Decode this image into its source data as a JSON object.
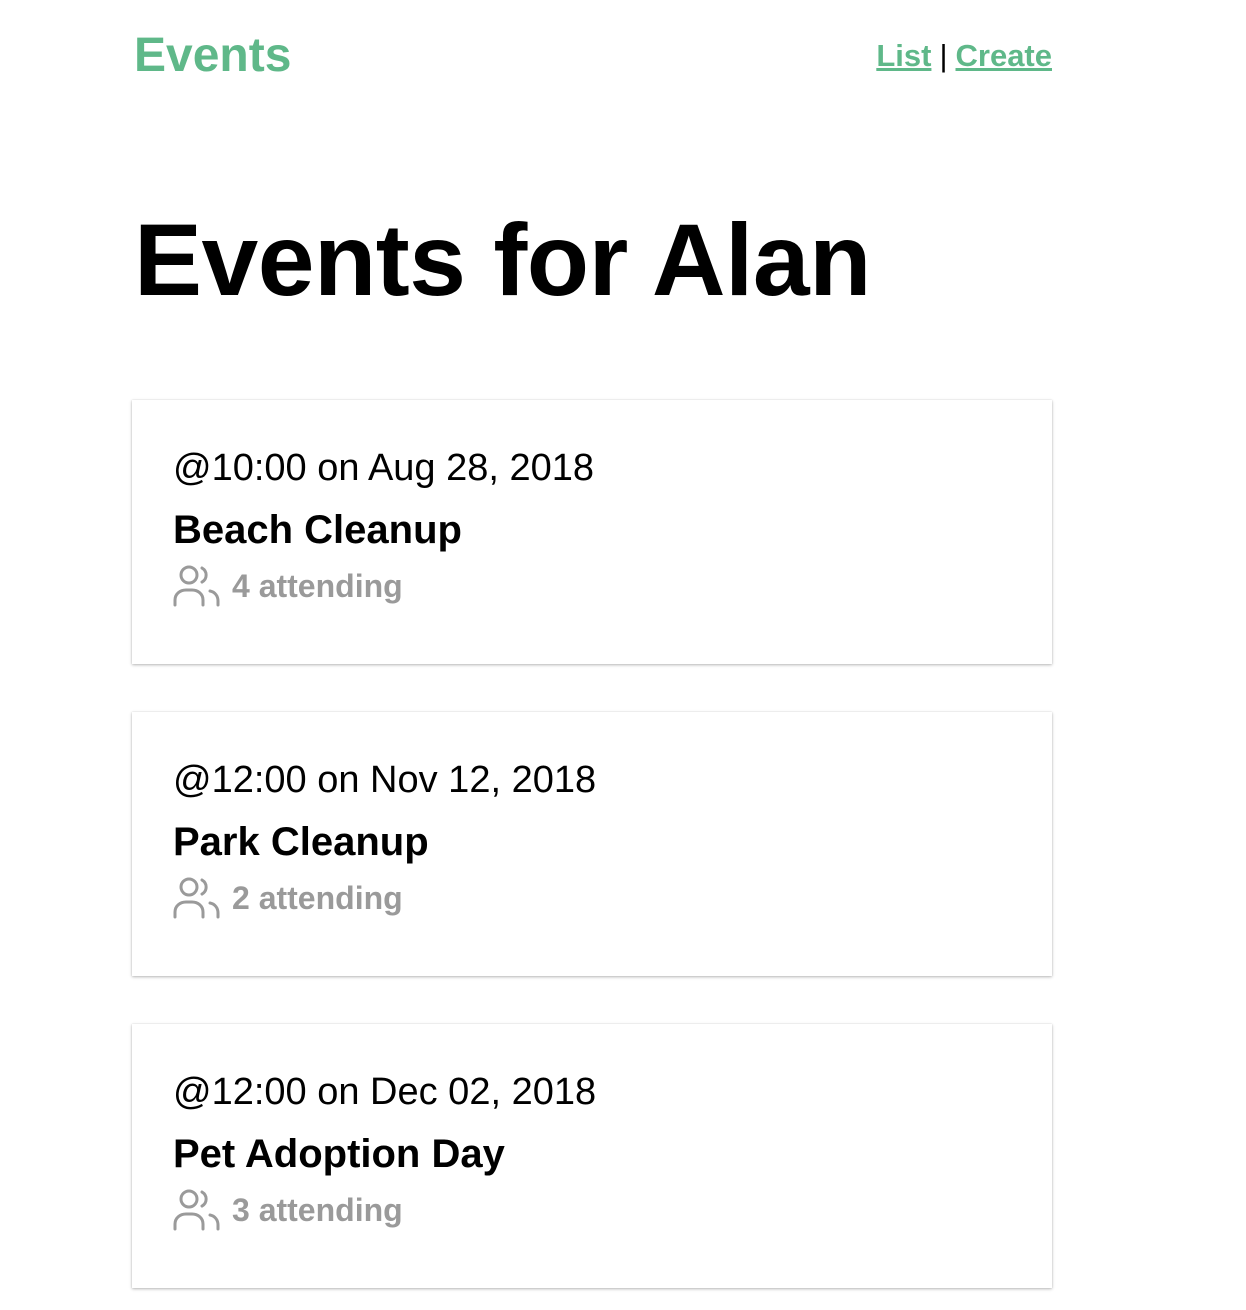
{
  "header": {
    "brand": "Events",
    "nav": {
      "list_label": "List",
      "separator": "|",
      "create_label": "Create"
    }
  },
  "page_title": "Events for Alan",
  "events": [
    {
      "when": "@10:00 on Aug 28, 2018",
      "title": "Beach Cleanup",
      "attending": "4 attending",
      "icon": "users-icon"
    },
    {
      "when": "@12:00 on Nov 12, 2018",
      "title": "Park Cleanup",
      "attending": "2 attending",
      "icon": "users-icon"
    },
    {
      "when": "@12:00 on Dec 02, 2018",
      "title": "Pet Adoption Day",
      "attending": "3 attending",
      "icon": "users-icon"
    }
  ],
  "colors": {
    "brand": "#5fb889",
    "muted": "#9a9a9a"
  }
}
